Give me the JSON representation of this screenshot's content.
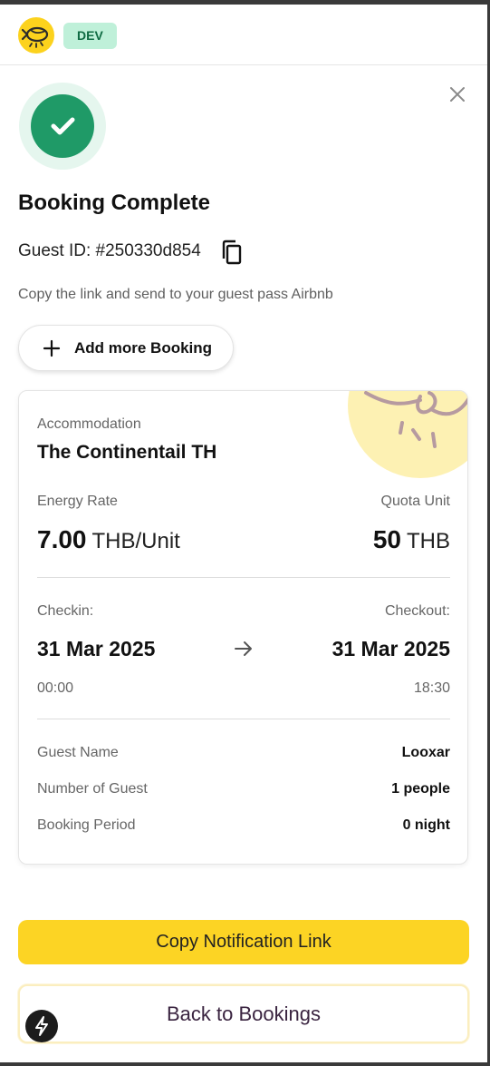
{
  "header": {
    "logo_icon": "fish-logo-icon",
    "env_badge": "DEV",
    "brand_color": "#fcd21d",
    "badge_color": "#bff0d9"
  },
  "dialog": {
    "close_icon": "close-icon",
    "status_icon": "check-circle-icon",
    "status_color": "#1f9a67",
    "title": "Booking Complete",
    "guest_id": "Guest ID: #250330d854",
    "copy_icon": "copy-icon",
    "subtitle": "Copy the link and send to your guest pass Airbnb",
    "add_button_label": "Add more Booking"
  },
  "booking": {
    "accommodation_label": "Accommodation",
    "accommodation_name": "The Continentail TH",
    "energy_rate_label": "Energy Rate",
    "energy_rate_value": "7.00",
    "energy_rate_unit": "THB/Unit",
    "quota_unit_label": "Quota Unit",
    "quota_unit_value": "50",
    "quota_unit_currency": "THB",
    "checkin_label": "Checkin:",
    "checkin_date": "31 Mar 2025",
    "checkin_time": "00:00",
    "checkout_label": "Checkout:",
    "checkout_date": "31 Mar 2025",
    "checkout_time": "18:30",
    "guest_name_label": "Guest Name",
    "guest_name_value": "Looxar",
    "guest_count_label": "Number of Guest",
    "guest_count_value": "1 people",
    "period_label": "Booking Period",
    "period_value": "0 night"
  },
  "actions": {
    "copy_link_label": "Copy Notification Link",
    "back_label": "Back to Bookings",
    "primary_color": "#fcd424",
    "fab_icon": "lightning-icon"
  }
}
